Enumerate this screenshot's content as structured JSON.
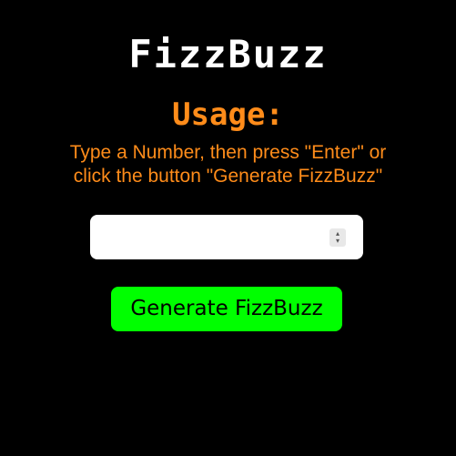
{
  "header": {
    "title": "FizzBuzz"
  },
  "usage": {
    "heading": "Usage:",
    "line1": "Type a Number, then press \"Enter\" or",
    "line2": "click the button \"Generate FizzBuzz\""
  },
  "input": {
    "value": "",
    "placeholder": "",
    "increment_icon": "chevron-up-icon",
    "decrement_icon": "chevron-down-icon"
  },
  "button": {
    "label": "Generate FizzBuzz"
  },
  "colors": {
    "background": "#000000",
    "title": "#ffffff",
    "accent_orange": "#ff8c1a",
    "button_green": "#00ff00"
  }
}
